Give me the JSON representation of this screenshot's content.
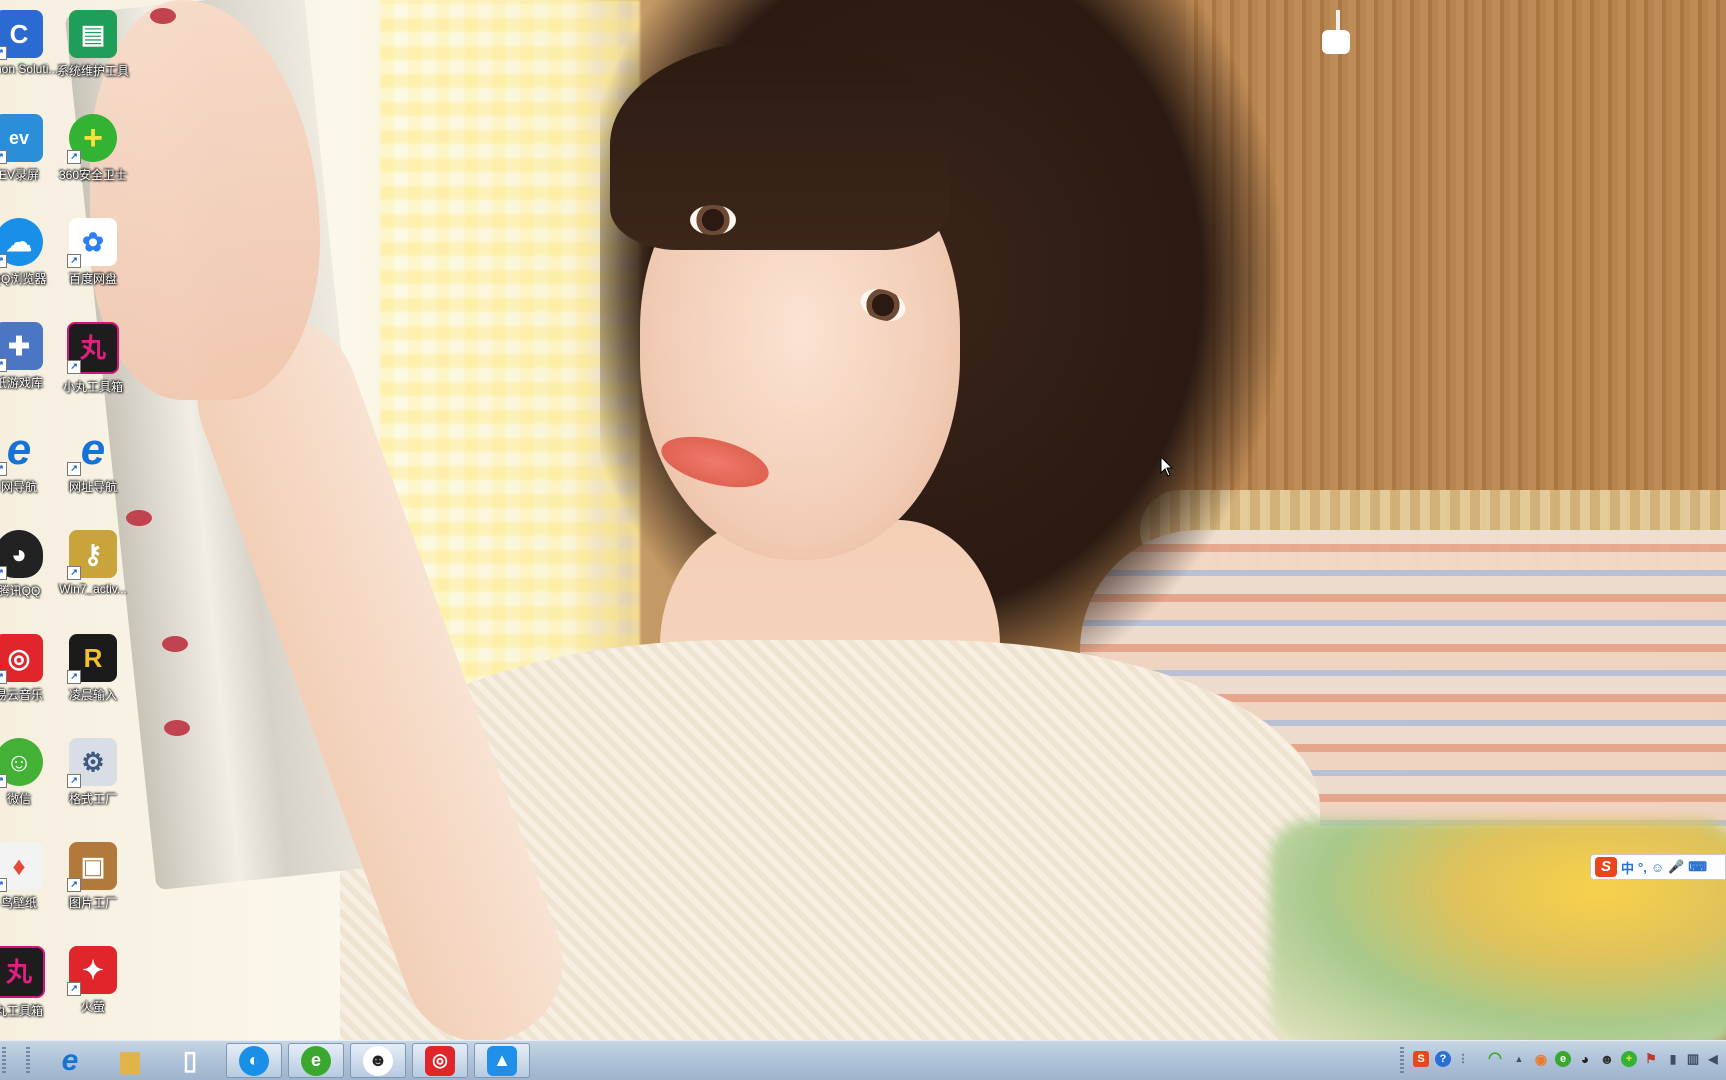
{
  "desktop": {
    "icons": [
      {
        "label": "Canon Soluti...",
        "icon": "canon-icon",
        "color": "#2b6ad1"
      },
      {
        "label": "系统维护工具",
        "icon": "folder-tools-icon",
        "color": "#1e9e58"
      },
      {
        "label": "EV录屏",
        "icon": "ev-recorder-icon",
        "color": "#2a8fd8"
      },
      {
        "label": "360安全卫士",
        "icon": "360-security-icon",
        "color": "#34b233"
      },
      {
        "label": "QQ浏览器",
        "icon": "qq-browser-icon",
        "color": "#1a8fe8"
      },
      {
        "label": "百度网盘",
        "icon": "baidu-netdisk-icon",
        "color": "#2b7ff2"
      },
      {
        "label": "纸游戏库",
        "icon": "game-library-icon",
        "color": "#4a76c4"
      },
      {
        "label": "小丸工具箱",
        "icon": "xiaowan-toolbox-icon",
        "color": "#d1157a"
      },
      {
        "label": "网导航",
        "icon": "ie-navigation-icon",
        "color": "#1673d6"
      },
      {
        "label": "网址导航",
        "icon": "ie-navigation-icon",
        "color": "#1673d6"
      },
      {
        "label": "腾讯QQ",
        "icon": "qq-penguin-icon",
        "color": "#222222"
      },
      {
        "label": "Win7_activ...",
        "icon": "key-icon",
        "color": "#c9a43a"
      },
      {
        "label": "易云音乐",
        "icon": "netease-music-icon",
        "color": "#e0262b"
      },
      {
        "label": "凌晨输入",
        "icon": "r-input-icon",
        "color": "#1b1b1b"
      },
      {
        "label": "微信",
        "icon": "wechat-icon",
        "color": "#43b036"
      },
      {
        "label": "格式工厂",
        "icon": "format-factory-icon",
        "color": "#6d8bb5"
      },
      {
        "label": "鸟壁纸",
        "icon": "bird-wallpaper-icon",
        "color": "#e24a3a"
      },
      {
        "label": "图片工厂",
        "icon": "picture-factory-icon",
        "color": "#b17a3c"
      },
      {
        "label": "丸工具箱",
        "icon": "xiaowan-toolbox-icon",
        "color": "#d1157a"
      },
      {
        "label": "火萤",
        "icon": "huoying-icon",
        "color": "#e0262b"
      }
    ]
  },
  "glyphs": {
    "canon": "C",
    "tools": "▤",
    "ev": "ev",
    "plus": "+",
    "cloud": "☁",
    "baidu": "✿",
    "game": "✚",
    "wan": "丸",
    "ie": "e",
    "penguin": "◕",
    "key": "⚷",
    "music": "◎",
    "r": "R",
    "chat": "☺",
    "factory": "⚙",
    "bird": "♦",
    "photo": "▣",
    "fire": "✦",
    "shortcut": "↗"
  },
  "ime": {
    "logo": "S",
    "mode": "中",
    "punct": "°,",
    "emoji": "☺",
    "mic": "🎤",
    "keyboard": "⌨"
  },
  "taskbar": {
    "buttons": [
      {
        "name": "ie-taskbar-button",
        "icon": "internet-explorer-icon",
        "glyph": "e",
        "color": "#1673d6",
        "active": false
      },
      {
        "name": "explorer-taskbar-button",
        "icon": "folder-icon",
        "glyph": "▆",
        "color": "#e2b34a",
        "active": false
      },
      {
        "name": "document-taskbar-button",
        "icon": "blank-document-icon",
        "glyph": "▯",
        "color": "#ffffff",
        "active": false
      },
      {
        "name": "qq-browser-taskbar-button",
        "icon": "qq-browser-icon",
        "glyph": "◐",
        "color": "#1a8fe8",
        "active": true
      },
      {
        "name": "green-browser-taskbar-button",
        "icon": "green-e-icon",
        "glyph": "e",
        "color": "#3aa72f",
        "active": true
      },
      {
        "name": "panda-taskbar-button",
        "icon": "panda-icon",
        "glyph": "☻",
        "color": "#ffffff",
        "active": true
      },
      {
        "name": "netease-music-taskbar-button",
        "icon": "netease-music-icon",
        "glyph": "◎",
        "color": "#e0262b",
        "active": true
      },
      {
        "name": "app-taskbar-button",
        "icon": "mountain-app-icon",
        "glyph": "▲",
        "color": "#1f8fea",
        "active": true
      }
    ],
    "tray": [
      {
        "icon": "sogou-ime-icon",
        "glyph": "S",
        "color": "#e8461c"
      },
      {
        "icon": "help-icon",
        "glyph": "?",
        "color": "#2a6fd6"
      },
      {
        "icon": "tray-expand-icon",
        "glyph": "⋮",
        "color": "#5a6f88"
      },
      {
        "icon": "wifi-icon",
        "glyph": "◠",
        "color": "#3aa72f"
      },
      {
        "icon": "show-hidden-icon",
        "glyph": "▲",
        "color": "#3d4f66"
      },
      {
        "icon": "color-app-icon",
        "glyph": "◉",
        "color": "#e87a2a"
      },
      {
        "icon": "green-app-icon",
        "glyph": "e",
        "color": "#3aa72f"
      },
      {
        "icon": "qq-tray-icon",
        "glyph": "◕",
        "color": "#222222"
      },
      {
        "icon": "user-tray-icon",
        "glyph": "☻",
        "color": "#333333"
      },
      {
        "icon": "360-tray-icon",
        "glyph": "+",
        "color": "#34b233"
      },
      {
        "icon": "flag-icon",
        "glyph": "⚑",
        "color": "#ffffff"
      },
      {
        "icon": "power-icon",
        "glyph": "▮",
        "color": "#3d4f66"
      },
      {
        "icon": "network-icon",
        "glyph": "▥",
        "color": "#3d4f66"
      },
      {
        "icon": "volume-icon",
        "glyph": "◀",
        "color": "#3d4f66"
      }
    ]
  }
}
